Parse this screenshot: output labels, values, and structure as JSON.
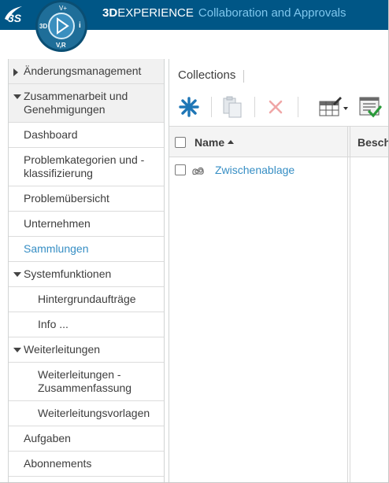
{
  "header": {
    "brand_bold": "3D",
    "brand_rest": "EXPERIENCE",
    "app_name": "Collaboration and Approvals",
    "compass": {
      "top": "V+",
      "left": "3D",
      "right": "i",
      "bottom": "V,R"
    },
    "bar_color": "#005686",
    "app_color": "#7fc7ee"
  },
  "sidebar": {
    "items": [
      {
        "label": "Änderungsmanagement",
        "kind": "category",
        "arrow": "right"
      },
      {
        "label": "Zusammenarbeit und Genehmigungen",
        "kind": "category",
        "arrow": "down"
      },
      {
        "label": "Dashboard",
        "kind": "item"
      },
      {
        "label": "Problemkategorien und -klassifizierung",
        "kind": "item"
      },
      {
        "label": "Problemübersicht",
        "kind": "item"
      },
      {
        "label": "Unternehmen",
        "kind": "item"
      },
      {
        "label": "Sammlungen",
        "kind": "item",
        "active": true
      },
      {
        "label": "Systemfunktionen",
        "kind": "group",
        "arrow": "down"
      },
      {
        "label": "Hintergrundaufträge",
        "kind": "subitem"
      },
      {
        "label": "Info ...",
        "kind": "subitem"
      },
      {
        "label": "Weiterleitungen",
        "kind": "group",
        "arrow": "down"
      },
      {
        "label": "Weiterleitungen - Zusammenfassung",
        "kind": "subitem"
      },
      {
        "label": "Weiterleitungsvorlagen",
        "kind": "subitem"
      },
      {
        "label": "Aufgaben",
        "kind": "item"
      },
      {
        "label": "Abonnements",
        "kind": "item"
      }
    ],
    "active_color": "#368ec4"
  },
  "panel": {
    "title": "Collections",
    "toolbar": [
      {
        "icon": "create-new-icon"
      },
      {
        "icon": "copy-icon"
      },
      {
        "icon": "delete-icon"
      },
      {
        "icon": "table-edit-icon"
      },
      {
        "icon": "approve-list-icon"
      }
    ],
    "columns": [
      "Name",
      "Besch"
    ],
    "rows": [
      {
        "name": "Zwischenablage",
        "icon": "collection-icon"
      }
    ],
    "link_color": "#368ec4"
  }
}
